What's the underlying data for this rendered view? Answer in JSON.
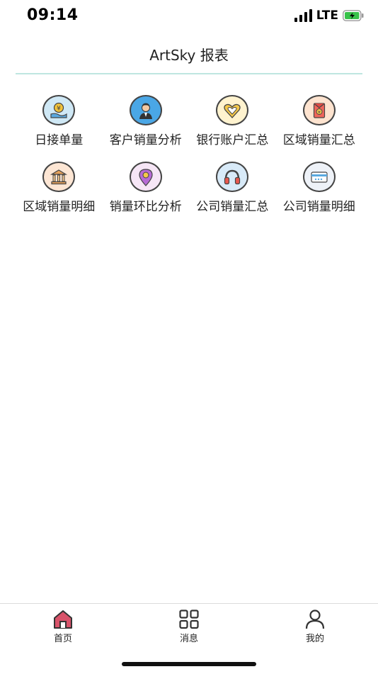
{
  "status_bar": {
    "time": "09:14",
    "network": "LTE",
    "battery_charging": true
  },
  "header": {
    "title": "ArtSky 报表"
  },
  "colors": {
    "divider": "#bfe6e0",
    "home_icon": "#d9536a",
    "battery": "#38c24a"
  },
  "grid": {
    "items": [
      {
        "label": "日接单量",
        "icon": "yuan-hand-icon"
      },
      {
        "label": "客户销量分析",
        "icon": "customer-icon"
      },
      {
        "label": "银行账户汇总",
        "icon": "heart-icon"
      },
      {
        "label": "区域销量汇总",
        "icon": "red-envelope-icon"
      },
      {
        "label": "区域销量明细",
        "icon": "bank-icon"
      },
      {
        "label": "销量环比分析",
        "icon": "location-pin-icon"
      },
      {
        "label": "公司销量汇总",
        "icon": "headphones-icon"
      },
      {
        "label": "公司销量明细",
        "icon": "card-icon"
      }
    ]
  },
  "tab_bar": {
    "tabs": [
      {
        "label": "首页",
        "icon": "home-icon",
        "active": true
      },
      {
        "label": "消息",
        "icon": "grid-icon",
        "active": false
      },
      {
        "label": "我的",
        "icon": "user-icon",
        "active": false
      }
    ]
  }
}
